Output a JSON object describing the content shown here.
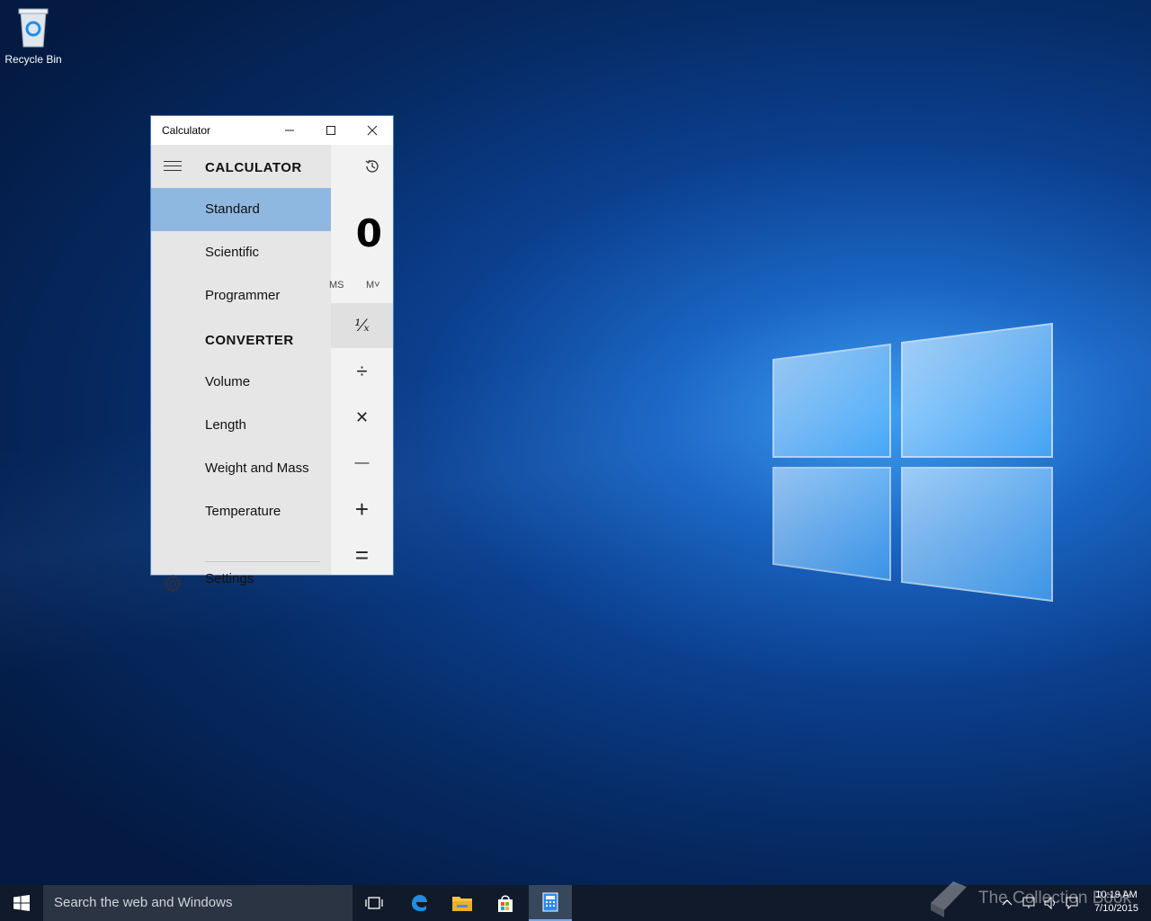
{
  "desktop": {
    "recycle_bin_label": "Recycle Bin"
  },
  "window": {
    "title": "Calculator",
    "minimize_label": "–",
    "maximize_label": "☐",
    "close_label": "✕"
  },
  "nav": {
    "calculator_header": "CALCULATOR",
    "converter_header": "CONVERTER",
    "items": [
      {
        "label": "Standard"
      },
      {
        "label": "Scientific"
      },
      {
        "label": "Programmer"
      },
      {
        "label": "Volume"
      },
      {
        "label": "Length"
      },
      {
        "label": "Weight and Mass"
      },
      {
        "label": "Temperature"
      }
    ],
    "settings_label": "Settings"
  },
  "calc": {
    "display": "0",
    "mem_ms": "MS",
    "mem_mdrop": "M˅",
    "keys": {
      "reciprocal": "¹⁄ₓ",
      "divide": "÷",
      "multiply": "✕",
      "minus": "—",
      "plus": "+",
      "equals": "="
    }
  },
  "taskbar": {
    "search_placeholder": "Search the web and Windows",
    "time": "10:19 AM",
    "date": "7/10/2015",
    "watermark": "The Collection Book",
    "icons": [
      "task-view-icon",
      "edge-icon",
      "file-explorer-icon",
      "store-icon",
      "calculator-icon"
    ]
  },
  "colors": {
    "selected_nav": "#8fb8e0",
    "window_border": "#3f7fd6",
    "taskbar": "#101a2a"
  }
}
